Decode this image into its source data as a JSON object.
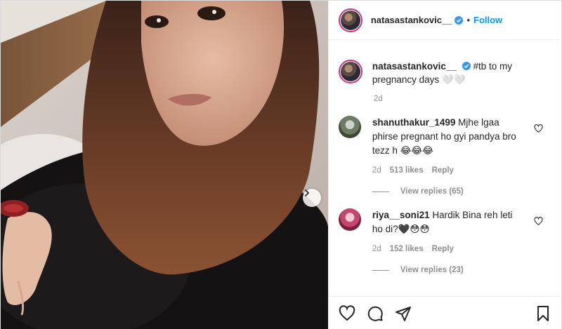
{
  "post": {
    "author": "natasastankovic__",
    "follow_label": "Follow",
    "separator": "•",
    "caption_text": "#tb to my pregnancy days 🤍🤍",
    "caption_time": "2d"
  },
  "comments": [
    {
      "user": "shanuthakur_1499",
      "text": "Mjhe lgaa phirse pregnant ho gyi pandya bro tezz h 😂😂😂",
      "time": "2d",
      "likes": "513 likes",
      "reply_label": "Reply",
      "view_replies": "View replies (65)"
    },
    {
      "user": "riya__soni21",
      "text": "Hardik Bina reh leti ho di?🖤😳😳",
      "time": "2d",
      "likes": "152 likes",
      "reply_label": "Reply",
      "view_replies": "View replies (23)"
    }
  ],
  "icons": {
    "like": "heart-icon",
    "comment": "comment-icon",
    "share": "share-icon",
    "save": "bookmark-icon",
    "next": "chevron-right-icon",
    "verified": "verified-badge-icon"
  },
  "colors": {
    "link_blue": "#0095f6",
    "muted_text": "#8e8e8e",
    "verified_blue": "#3897f0"
  }
}
